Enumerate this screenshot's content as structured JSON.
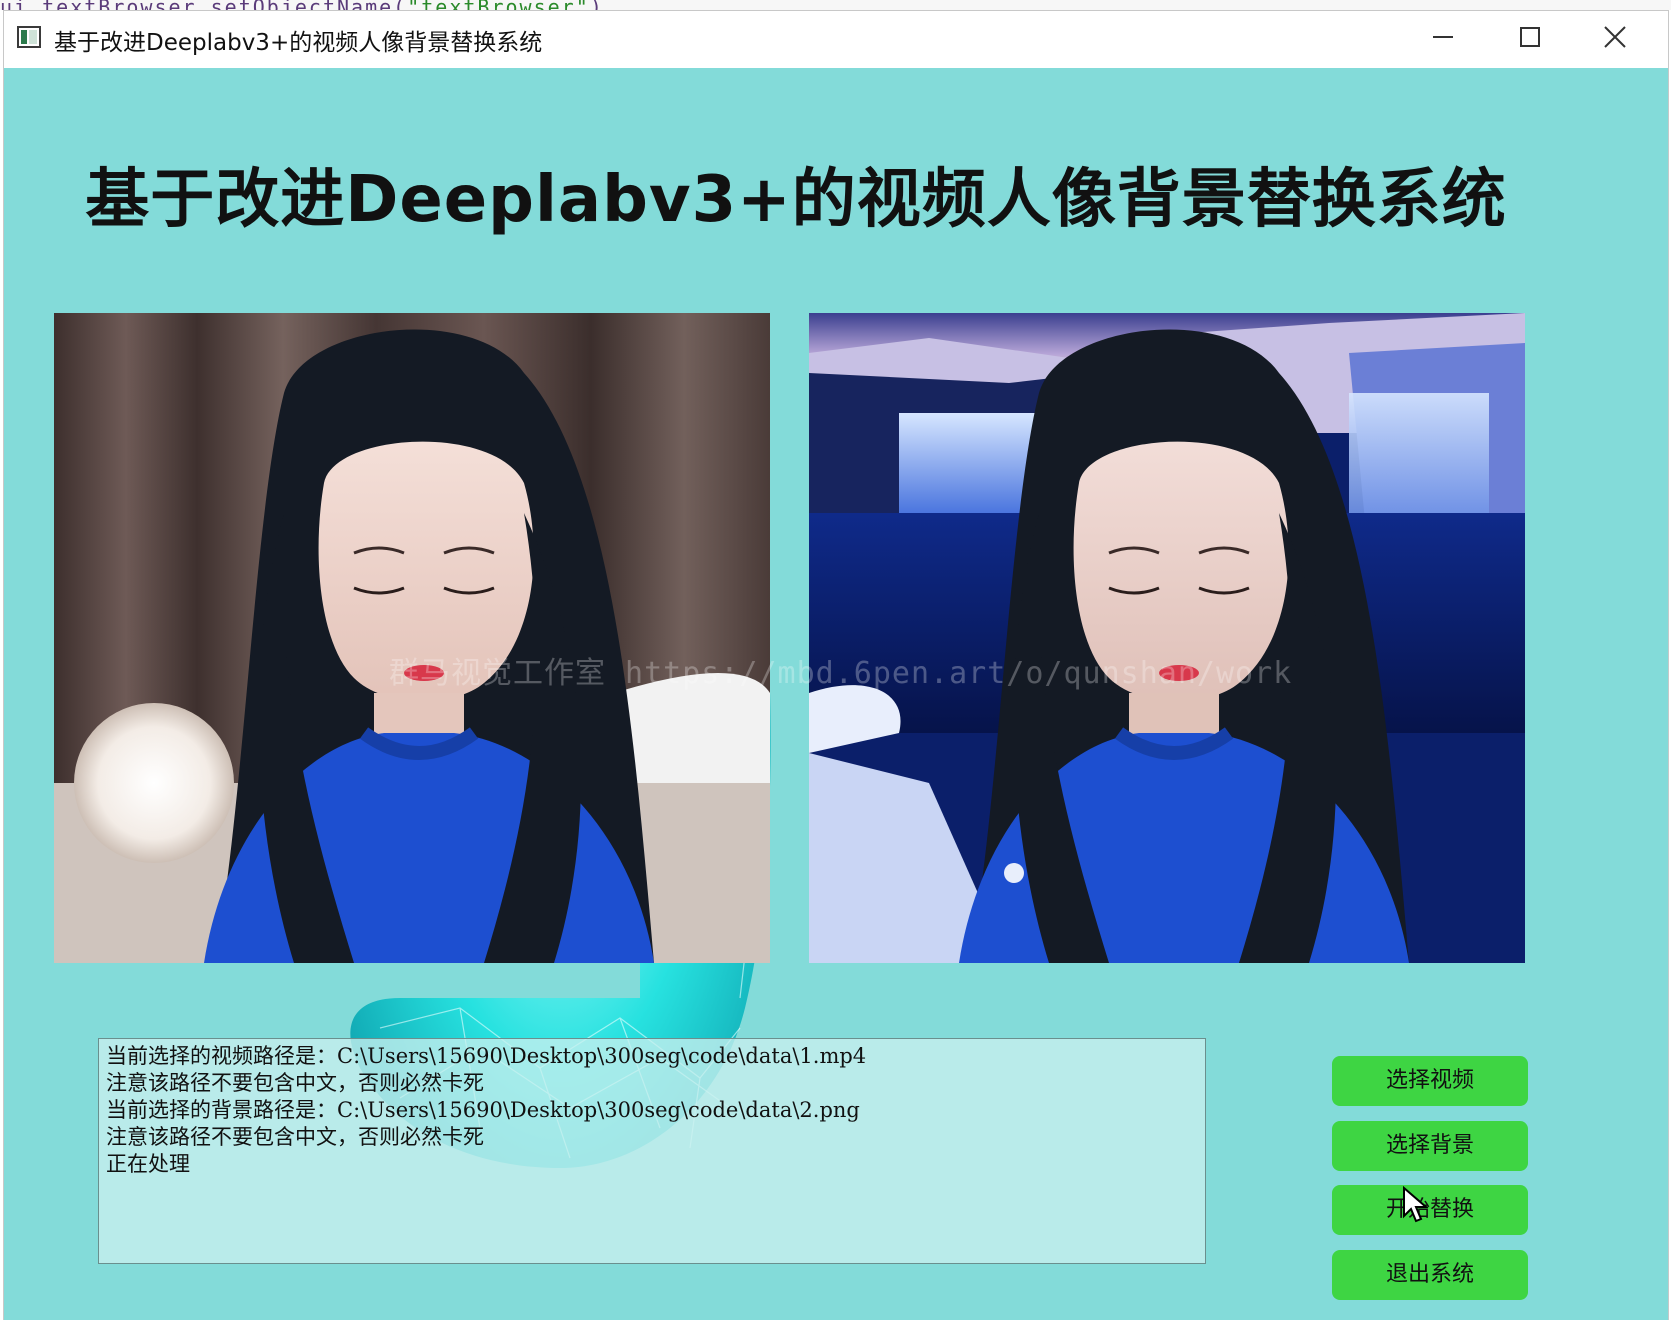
{
  "background_code": {
    "prefix": "ui.textBrowser.setObjectName(",
    "string": "\"textBrowser\"",
    "suffix": ")"
  },
  "window": {
    "title": "基于改进Deeplabv3+的视频人像背景替换系统",
    "controls": [
      "minimize-icon",
      "maximize-icon",
      "close-icon"
    ]
  },
  "main": {
    "heading": "基于改进Deeplabv3+的视频人像背景替换系统",
    "watermark": "群马视觉工作室 https://mbd.6pen.art/o/qunshan/work",
    "original_video": {
      "icon": "video-frame-original"
    },
    "result_video": {
      "icon": "video-frame-replaced-background"
    }
  },
  "log": {
    "lines": [
      "当前选择的视频路径是：C:\\Users\\15690\\Desktop\\300seg\\code\\data\\1.mp4",
      "注意该路径不要包含中文，否则必然卡死",
      "当前选择的背景路径是：C:\\Users\\15690\\Desktop\\300seg\\code\\data\\2.png",
      "注意该路径不要包含中文，否则必然卡死",
      "正在处理"
    ]
  },
  "buttons": {
    "select_video": "选择视频",
    "select_background": "选择背景",
    "start_replace": "开始替换",
    "exit_system": "退出系统"
  },
  "colors": {
    "client_bg": "#83dbd9",
    "button_bg": "#3ed543",
    "glow": "#19e3e0"
  }
}
